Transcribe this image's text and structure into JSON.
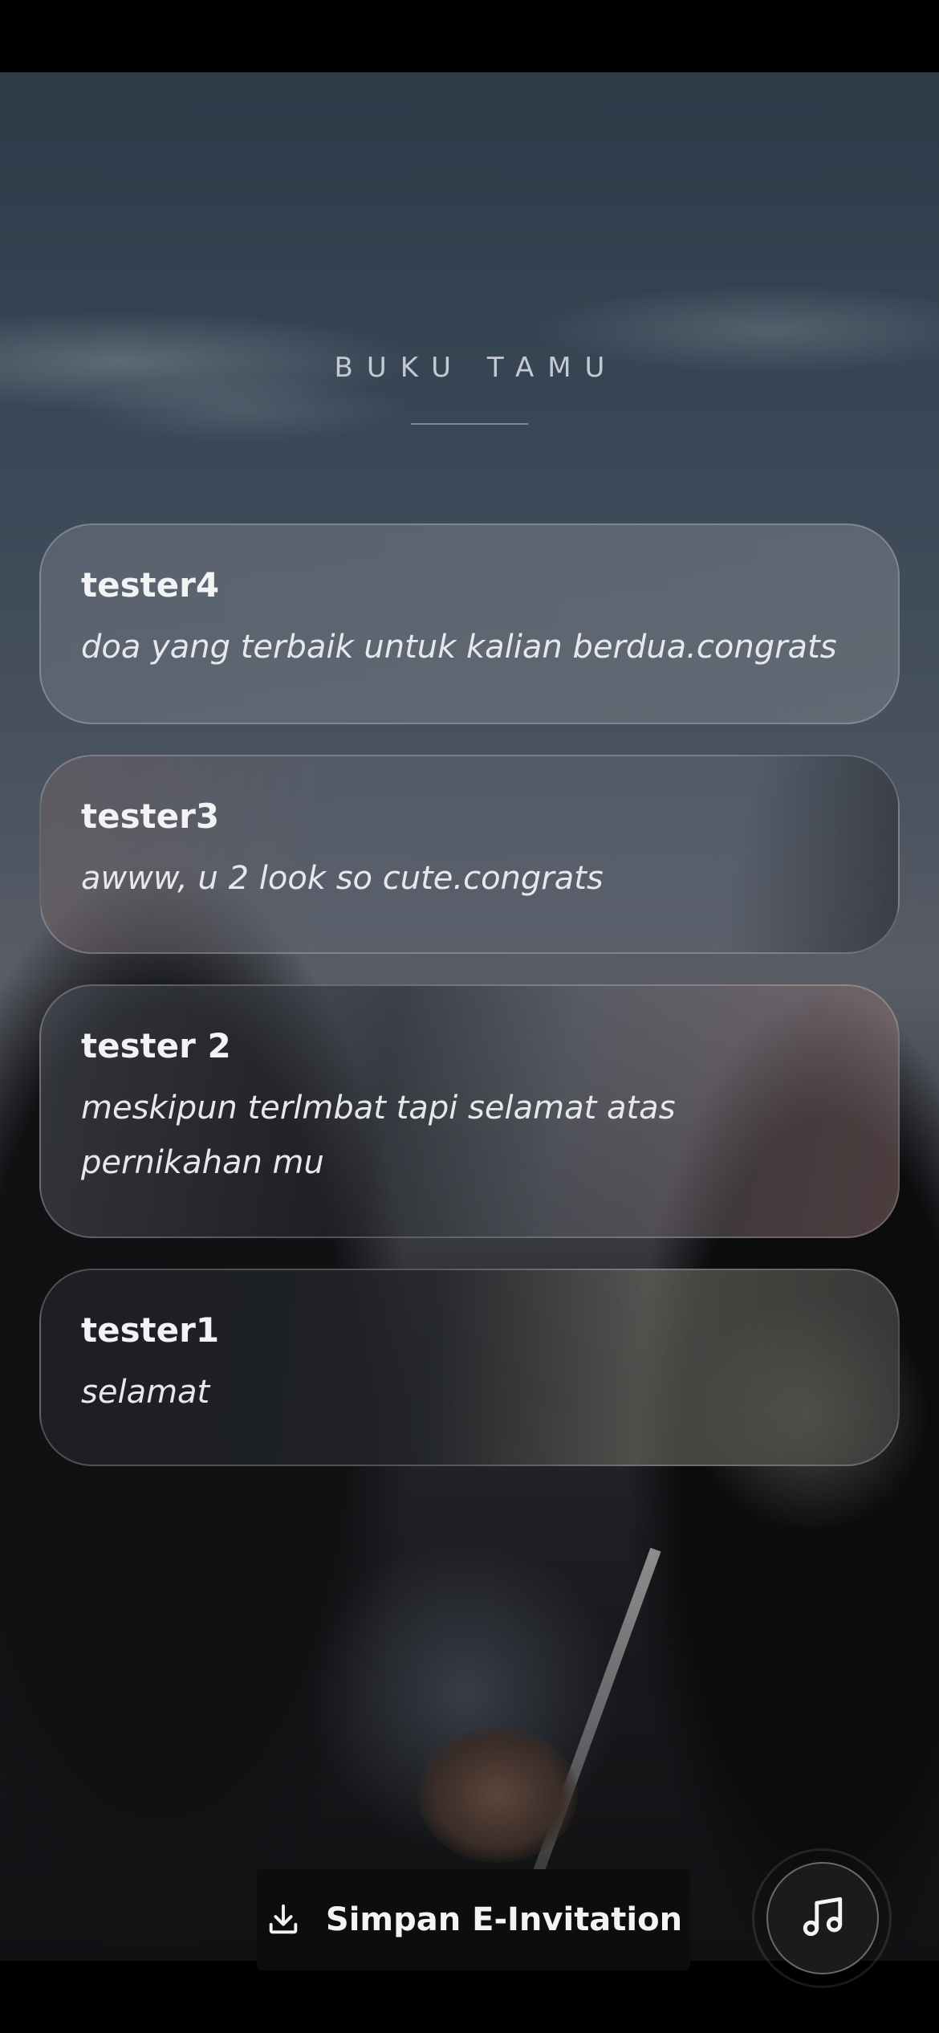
{
  "guestbook": {
    "title": "BUKU TAMU",
    "entries": [
      {
        "name": "tester4",
        "message": "doa yang terbaik untuk kalian berdua.congrats"
      },
      {
        "name": "tester3",
        "message": "awww, u 2 look so cute.congrats"
      },
      {
        "name": "tester 2",
        "message": "meskipun terlmbat tapi selamat atas pernikahan mu"
      },
      {
        "name": "tester1",
        "message": "selamat"
      }
    ]
  },
  "footer": {
    "save_label": "Simpan E-Invitation",
    "save_icon": "download-icon",
    "music_icon": "music-note-icon"
  }
}
